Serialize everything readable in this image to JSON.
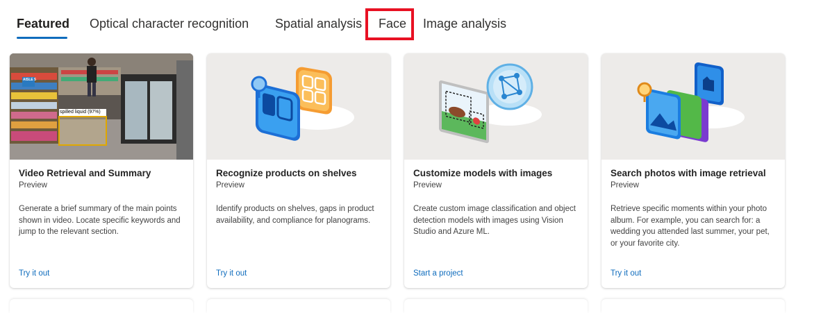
{
  "tabs": [
    {
      "label": "Featured",
      "active": true
    },
    {
      "label": "Optical character recognition",
      "active": false
    },
    {
      "label": "Spatial analysis",
      "active": false
    },
    {
      "label": "Face",
      "active": false,
      "highlighted": true
    },
    {
      "label": "Image analysis",
      "active": false
    }
  ],
  "cards": [
    {
      "title": "Video Retrieval and Summary",
      "badge": "Preview",
      "description": "Generate a brief summary of the main points shown in video. Locate specific keywords and jump to the relevant section.",
      "cta": "Try it out",
      "image_label": "spilled liquid (97%)",
      "store_sign": "AISLE 5"
    },
    {
      "title": "Recognize products on shelves",
      "badge": "Preview",
      "description": "Identify products on shelves, gaps in product availability, and compliance for planograms.",
      "cta": "Try it out"
    },
    {
      "title": "Customize models with images",
      "badge": "Preview",
      "description": "Create custom image classification and object detection models with images using Vision Studio and Azure ML.",
      "cta": "Start a project"
    },
    {
      "title": "Search photos with image retrieval",
      "badge": "Preview",
      "description": "Retrieve specific moments within your photo album. For example, you can search for: a wedding you attended last summer, your pet, or your favorite city.",
      "cta": "Try it out"
    }
  ],
  "colors": {
    "accent": "#0f6cbd",
    "highlight_box": "#e81123",
    "card_media_bg": "#edebe9"
  }
}
